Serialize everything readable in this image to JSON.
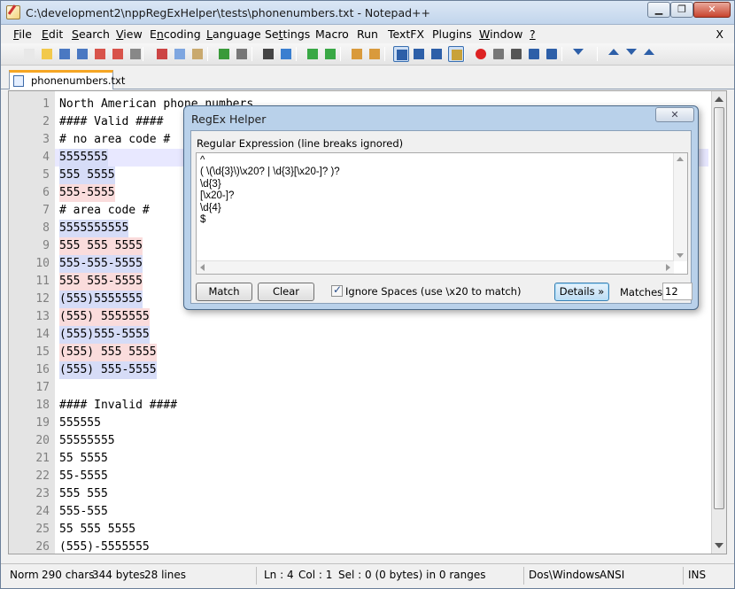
{
  "window": {
    "title": "C:\\development2\\nppRegExHelper\\tests\\phonenumbers.txt - Notepad++",
    "controls": [
      "▁",
      "❐",
      "✕"
    ]
  },
  "menu": [
    {
      "pre": "",
      "u": "F",
      "post": "ile"
    },
    {
      "pre": "",
      "u": "E",
      "post": "dit"
    },
    {
      "pre": "",
      "u": "S",
      "post": "earch"
    },
    {
      "pre": "",
      "u": "V",
      "post": "iew"
    },
    {
      "pre": "E",
      "u": "n",
      "post": "coding"
    },
    {
      "pre": "",
      "u": "L",
      "post": "anguage"
    },
    {
      "pre": "Se",
      "u": "t",
      "post": "tings"
    },
    {
      "pre": "Macro",
      "u": "",
      "post": ""
    },
    {
      "pre": "Run",
      "u": "",
      "post": ""
    },
    {
      "pre": "TextFX",
      "u": "",
      "post": ""
    },
    {
      "pre": "Plugins",
      "u": "",
      "post": ""
    },
    {
      "pre": "",
      "u": "W",
      "post": "indow"
    },
    {
      "pre": "",
      "u": "?",
      "post": ""
    }
  ],
  "menu_close": "X",
  "toolbar": [
    "new-file-icon",
    "open-file-icon",
    "save-icon",
    "save-all-icon",
    "close-icon",
    "close-all-icon",
    "print-icon",
    "cut-icon",
    "copy-icon",
    "paste-icon",
    "undo-icon",
    "redo-icon",
    "find-icon",
    "replace-icon",
    "zoom-in-icon",
    "zoom-out-icon",
    "sync-vertical-icon",
    "sync-horizontal-icon",
    "word-wrap-icon",
    "show-all-chars-icon",
    "indent-guide-icon",
    "doc-map-icon",
    "record-macro-icon",
    "stop-record-icon",
    "play-macro-icon",
    "run-macro-multiple-icon",
    "save-macro-icon",
    "regex-helper-icon",
    "up-arrow-icon",
    "down-arrow-icon",
    "collapse-icon"
  ],
  "tab": {
    "label": "phonenumbers.txt"
  },
  "editor": {
    "current_line": 4,
    "lines": [
      {
        "n": "1",
        "text": "North American phone numbers",
        "hl": ""
      },
      {
        "n": "2",
        "text": "#### Valid ####",
        "hl": ""
      },
      {
        "n": "3",
        "text": "# no area code #",
        "hl": ""
      },
      {
        "n": "4",
        "text": "5555555",
        "hl": "b"
      },
      {
        "n": "5",
        "text": "555 5555",
        "hl": "b"
      },
      {
        "n": "6",
        "text": "555-5555",
        "hl": "r"
      },
      {
        "n": "7",
        "text": "# area code #",
        "hl": ""
      },
      {
        "n": "8",
        "text": "5555555555",
        "hl": "b"
      },
      {
        "n": "9",
        "text": "555 555 5555",
        "hl": "r"
      },
      {
        "n": "10",
        "text": "555-555-5555",
        "hl": "b"
      },
      {
        "n": "11",
        "text": "555 555-5555",
        "hl": "r"
      },
      {
        "n": "12",
        "text": "(555)5555555",
        "hl": "b"
      },
      {
        "n": "13",
        "text": "(555) 5555555",
        "hl": "r"
      },
      {
        "n": "14",
        "text": "(555)555-5555",
        "hl": "b"
      },
      {
        "n": "15",
        "text": "(555) 555 5555",
        "hl": "r"
      },
      {
        "n": "16",
        "text": "(555) 555-5555",
        "hl": "b"
      },
      {
        "n": "17",
        "text": "",
        "hl": ""
      },
      {
        "n": "18",
        "text": "#### Invalid ####",
        "hl": ""
      },
      {
        "n": "19",
        "text": "555555",
        "hl": ""
      },
      {
        "n": "20",
        "text": "55555555",
        "hl": ""
      },
      {
        "n": "21",
        "text": "55 5555",
        "hl": ""
      },
      {
        "n": "22",
        "text": "55-5555",
        "hl": ""
      },
      {
        "n": "23",
        "text": "555 555",
        "hl": ""
      },
      {
        "n": "24",
        "text": "555-555",
        "hl": ""
      },
      {
        "n": "25",
        "text": "55 555 5555",
        "hl": ""
      },
      {
        "n": "26",
        "text": "(555)-5555555",
        "hl": ""
      }
    ]
  },
  "dialog": {
    "title": "RegEx Helper",
    "close": "✕",
    "regex_label": "Regular Expression (line breaks ignored)",
    "regex_text": "^\n( \\(\\d{3}\\)\\x20? | \\d{3}[\\x20-]? )?\n\\d{3}\n[\\x20-]?\n\\d{4}\n$",
    "match_label": "Match",
    "clear_label": "Clear",
    "ignore_spaces_label": "Ignore Spaces (use \\x20 to match)",
    "ignore_spaces_checked": true,
    "details_label": "Details »",
    "matches_label": "Matches:",
    "matches_value": "12"
  },
  "status": {
    "norm": "Norm",
    "chars": "290 chars",
    "bytes": "344 bytes",
    "lines": "28 lines",
    "ln": "Ln : 4",
    "col": "Col : 1",
    "sel": "Sel : 0 (0 bytes) in 0 ranges",
    "eol": "Dos\\Windows",
    "enc": "ANSI",
    "ins": "INS"
  },
  "colors": {
    "match_a": "#d6dcf7",
    "match_b": "#fadcdc",
    "current_line": "#e8e8ff"
  }
}
